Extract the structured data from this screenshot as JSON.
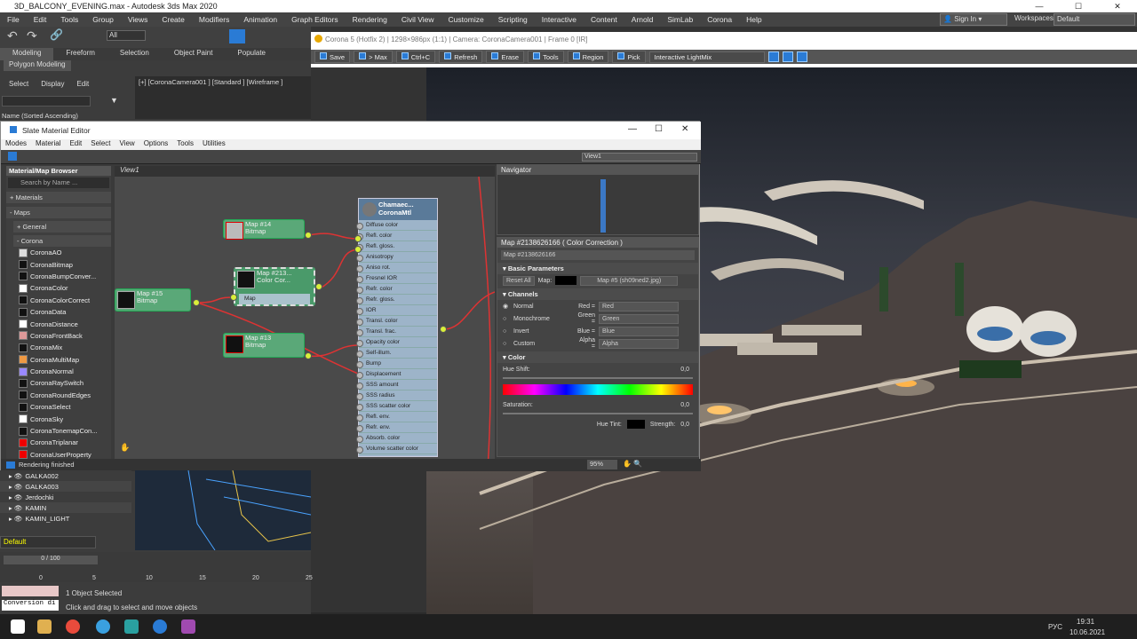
{
  "app": {
    "title": "3D_BALCONY_EVENING.max - Autodesk 3ds Max 2020",
    "sign_in": "Sign In",
    "workspaces_label": "Workspaces:",
    "workspace": "Default"
  },
  "menubar": [
    "File",
    "Edit",
    "Tools",
    "Group",
    "Views",
    "Create",
    "Modifiers",
    "Animation",
    "Graph Editors",
    "Rendering",
    "Civil View",
    "Customize",
    "Scripting",
    "Interactive",
    "Content",
    "Arnold",
    "SimLab",
    "Corona",
    "Help"
  ],
  "ribbon": {
    "tabs": [
      "Modeling",
      "Freeform",
      "Selection",
      "Object Paint",
      "Populate"
    ],
    "sub": "Polygon Modeling",
    "selection_filter": "All"
  },
  "scene_explorer": {
    "tabs": [
      "Select",
      "Display",
      "Edit"
    ],
    "sort_label": "Name (Sorted Ascending)",
    "items": [
      "GALKA002",
      "GALKA003",
      "Jerdochki",
      "KAMIN",
      "KAMIN_LIGHT"
    ]
  },
  "viewport": {
    "label": "[+] [CoronaCamera001 ] [Standard ] [Wireframe ]"
  },
  "vfb": {
    "title": "Corona 5 (Hotfix 2) | 1298×986px (1:1) | Camera: CoronaCamera001 | Frame 0 [IR]",
    "buttons": [
      "Save",
      "> Max",
      "Ctrl+C",
      "Refresh",
      "Erase",
      "Tools",
      "Region",
      "Pick"
    ],
    "lightmix": "Interactive LightMix"
  },
  "sme": {
    "title": "Slate Material Editor",
    "menu": [
      "Modes",
      "Material",
      "Edit",
      "Select",
      "View",
      "Options",
      "Tools",
      "Utilities"
    ],
    "view_dropdown": "View1",
    "status": "Rendering finished",
    "zoom": "95%",
    "browser": {
      "title": "Material/Map Browser",
      "search": "Search by Name ...",
      "materials": "+ Materials",
      "maps": "- Maps",
      "general": "+ General",
      "corona": "- Corona",
      "items": [
        {
          "name": "CoronaAO",
          "color": "#ddd"
        },
        {
          "name": "CoronaBitmap",
          "color": "#111"
        },
        {
          "name": "CoronaBumpConver...",
          "color": "#111"
        },
        {
          "name": "CoronaColor",
          "color": "#fff"
        },
        {
          "name": "CoronaColorCorrect",
          "color": "#111"
        },
        {
          "name": "CoronaData",
          "color": "#111"
        },
        {
          "name": "CoronaDistance",
          "color": "#fff"
        },
        {
          "name": "CoronaFrontBack",
          "color": "#d99"
        },
        {
          "name": "CoronaMix",
          "color": "#111"
        },
        {
          "name": "CoronaMultiMap",
          "color": "#e94"
        },
        {
          "name": "CoronaNormal",
          "color": "#98f"
        },
        {
          "name": "CoronaRaySwitch",
          "color": "#111"
        },
        {
          "name": "CoronaRoundEdges",
          "color": "#111"
        },
        {
          "name": "CoronaSelect",
          "color": "#111"
        },
        {
          "name": "CoronaSky",
          "color": "#fff"
        },
        {
          "name": "CoronaTonemapCon...",
          "color": "#111"
        },
        {
          "name": "CoronaTriplanar",
          "color": "#e00"
        },
        {
          "name": "CoronaUserProperty",
          "color": "#e00"
        }
      ]
    },
    "view_tab": "View1",
    "nodes": {
      "map14": [
        "Map #14",
        "Bitmap"
      ],
      "map213": [
        "Map #213...",
        "Color Cor..."
      ],
      "map213_in": "Map",
      "map15": [
        "Map #15",
        "Bitmap"
      ],
      "map13": [
        "Map #13",
        "Bitmap"
      ],
      "material": [
        "Chamaec...",
        "CoronaMtl"
      ],
      "slots": [
        "Diffuse color",
        "Refl. color",
        "Refl. gloss.",
        "Anisotropy",
        "Aniso rot.",
        "Fresnel IOR",
        "Refr. color",
        "Refr. gloss.",
        "IOR",
        "Transl. color",
        "Transl. frac.",
        "Opacity color",
        "Self-illum.",
        "Bump",
        "Displacement",
        "SSS amount",
        "SSS radius",
        "SSS scatter color",
        "Refl. env.",
        "Refr. env.",
        "Absorb. color",
        "Volume scatter color"
      ]
    },
    "navigator": "Navigator",
    "params": {
      "title": "Map #2138626166  ( Color Correction )",
      "name": "Map #2138626166",
      "basic": "Basic Parameters",
      "reset": "Reset All",
      "map_label": "Map:",
      "map_value": "Map #5 (sh09ned2.jpg)",
      "channels": "Channels",
      "modes": [
        "Normal",
        "Monochrome",
        "Invert",
        "Custom"
      ],
      "red_label": "Red =",
      "red": "Red",
      "green_label": "Green =",
      "green": "Green",
      "blue_label": "Blue =",
      "blue": "Blue",
      "alpha_label": "Alpha =",
      "alpha": "Alpha",
      "color": "Color",
      "hue_shift": "Hue Shift:",
      "hue_value": "0,0",
      "saturation": "Saturation:",
      "sat_value": "0,0",
      "hue_tint": "Hue Tint:",
      "strength": "Strength:",
      "strength_value": "0,0"
    }
  },
  "layer": "Default",
  "timeline": {
    "frame": "0 / 100",
    "ticks": [
      "0",
      "5",
      "10",
      "15",
      "20",
      "25"
    ]
  },
  "status": {
    "maxscript": "Conversion di",
    "selected": "1 Object Selected",
    "hint": "Click and drag to select and move objects"
  },
  "taskbar": {
    "lang": "РУС",
    "time": "19:31",
    "date": "10.06.2021"
  }
}
